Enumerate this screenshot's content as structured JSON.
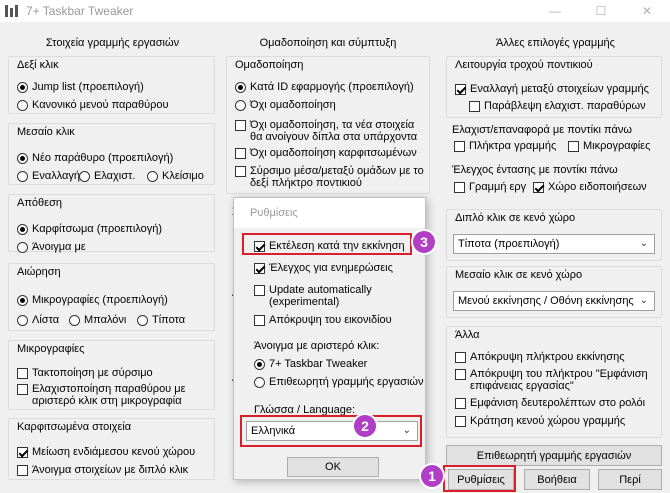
{
  "window": {
    "title": "7+ Taskbar Tweaker",
    "minimize": "—",
    "maximize": "☐",
    "close": "✕"
  },
  "col1": {
    "title": "Στοιχεία γραμμής εργασιών",
    "right_click": {
      "title": "Δεξί κλικ",
      "opt1": "Jump list (προεπιλογή)",
      "opt2": "Κανονικό μενού παραθύρου"
    },
    "middle_click": {
      "title": "Μεσαίο κλικ",
      "opt1": "Νέο παράθυρο (προεπιλογή)",
      "opt2": "Εναλλαγή",
      "opt3": "Ελαχιστ.",
      "opt4": "Κλείσιμο"
    },
    "drop": {
      "title": "Απόθεση",
      "opt1": "Καρφίτσωμα (προεπιλογή)",
      "opt2": "Άνοιγμα με"
    },
    "hover": {
      "title": "Αιώρηση",
      "opt1": "Μικρογραφίες (προεπιλογή)",
      "opt2": "Λίστα",
      "opt3": "Μπαλόνι",
      "opt4": "Τίποτα"
    },
    "thumbs": {
      "title": "Μικρογραφίες",
      "opt1": "Τακτοποίηση με σύρσιμο",
      "opt2": "Ελαχιστοποίηση παραθύρου με αριστερό κλικ στη μικρογραφία"
    },
    "pinned": {
      "title": "Καρφιτσωμένα στοιχεία",
      "opt1": "Μείωση ενδιάμεσου κενού χώρου",
      "opt2": "Άνοιγμα στοιχείων με διπλό κλικ"
    }
  },
  "col2": {
    "title": "Ομαδοποίηση και σύμπτυξη",
    "grouping": {
      "title": "Ομαδοποίηση",
      "opt1": "Κατά ID εφαρμογής (προεπιλογή)",
      "opt2": "Όχι ομαδοποίηση",
      "opt3": "Όχι ομαδοποίηση, τα νέα στοιχεία θα ανοίγουν δίπλα στα υπάρχοντα",
      "opt4": "Όχι ομαδοποίηση καρφιτσωμένων",
      "opt5": "Σύρσιμο μέσα/μεταξύ ομάδων με το δεξί πλήκτρο ποντικιού"
    },
    "partial1": "Σύ",
    "partial2": "Α",
    "partial3": "Αρ"
  },
  "col3": {
    "title": "Άλλες επιλογές γραμμής",
    "wheel": {
      "title": "Λειτουργία τροχού ποντικιού",
      "opt1": "Εναλλαγή μεταξύ στοιχείων γραμμής",
      "opt2": "Παράβλεψη ελαχιστ. παραθύρων"
    },
    "minrestore": {
      "title": "Ελαχιστ/επαναφορά με ποντίκι πάνω",
      "opt1": "Πλήκτρα γραμμής",
      "opt2": "Μικρογραφίες"
    },
    "volume": {
      "title": "Έλεγχος έντασης με ποντίκι πάνω",
      "opt1": "Γραμμή εργ",
      "opt2": "Χώρο ειδοποιήσεων"
    },
    "dblclick": {
      "title": "Διπλό κλικ σε κενό χώρο",
      "value": "Τίποτα (προεπιλογή)"
    },
    "midclick": {
      "title": "Μεσαίο κλικ σε κενό χώρο",
      "value": "Μενού εκκίνησης / Οθόνη εκκίνησης"
    },
    "other": {
      "title": "Άλλα",
      "opt1": "Απόκρυψη πλήκτρου εκκίνησης",
      "opt2": "Απόκρυψη του πλήκτρου \"Εμφάνιση επιφάνειας εργασίας\"",
      "opt3": "Εμφάνιση δευτερολέπτων στο ρολόι",
      "opt4": "Κράτηση κενού χώρου γραμμής"
    },
    "taskbar_btn": "Επιθεωρητή γραμμής εργασιών"
  },
  "bottom": {
    "settings": "Ρυθμίσεις",
    "help": "Βοήθεια",
    "about": "Περί"
  },
  "dialog": {
    "title": "Ρυθμίσεις",
    "opt1": "Εκτέλεση κατά την εκκίνηση",
    "opt2": "Έλεγχος για ενημερώσεις",
    "opt3": "Update automatically (experimental)",
    "opt4": "Απόκρυψη του εικονιδίου",
    "leftclick_title": "Άνοιγμα με αριστερό κλικ:",
    "radio1": "7+ Taskbar Tweaker",
    "radio2": "Επιθεωρητή γραμμής εργασιών",
    "lang_title": "Γλώσσα / Language:",
    "lang_value": "Ελληνικά",
    "ok": "OK"
  },
  "badges": {
    "b1": "1",
    "b2": "2",
    "b3": "3"
  },
  "colors": {
    "highlight": "#d9202a",
    "badge": "#b03fc6"
  }
}
